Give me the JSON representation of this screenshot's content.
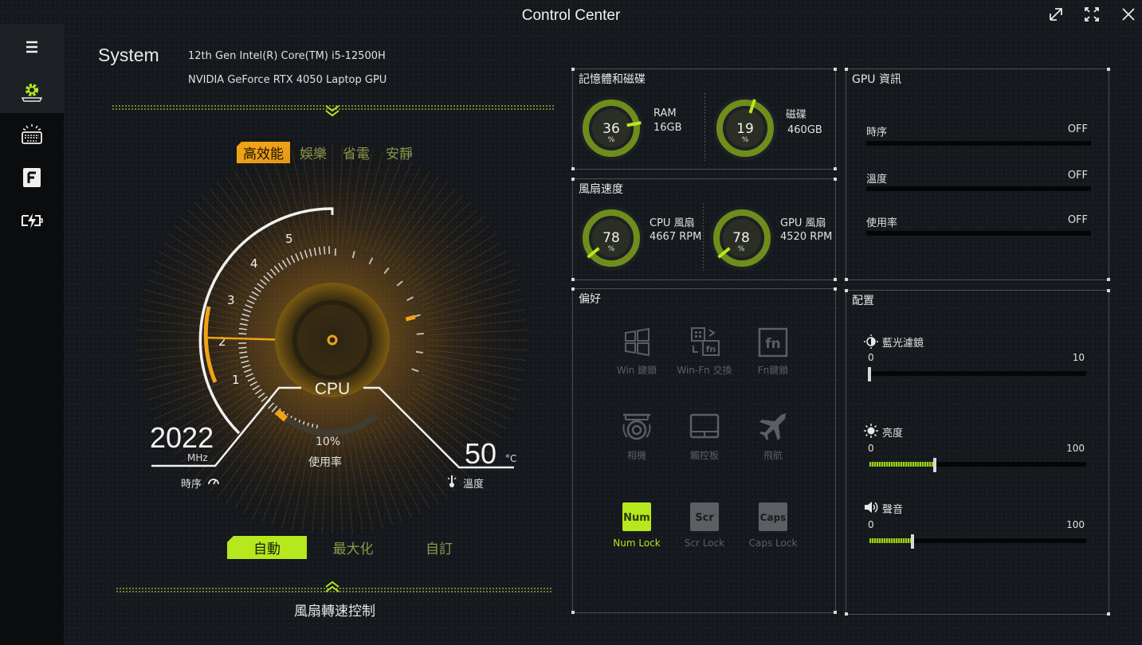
{
  "window": {
    "title": "Control Center",
    "buttons": [
      "restore-icon",
      "fullscreen-icon",
      "close-icon"
    ]
  },
  "sidebar": {
    "items": [
      {
        "icon": "hamburger-menu-icon"
      },
      {
        "icon": "gear-icon",
        "active": true
      },
      {
        "icon": "keyboard-backlight-icon"
      },
      {
        "icon": "f-key-icon"
      },
      {
        "icon": "battery-charge-icon"
      }
    ]
  },
  "system": {
    "label": "System",
    "cpu": "12th Gen Intel(R) Core(TM) i5-12500H",
    "gpu": "NVIDIA GeForce RTX 4050 Laptop GPU"
  },
  "power_modes": {
    "items": [
      "高效能",
      "娛樂",
      "省電",
      "安靜"
    ],
    "selected": "高效能"
  },
  "gauge": {
    "ticks": [
      "1",
      "2",
      "3",
      "4",
      "5"
    ],
    "center_label": "CPU",
    "clock_value": "2022",
    "clock_unit": "MHz",
    "clock_label": "時序",
    "usage_value": "10%",
    "usage_label": "使用率",
    "usage_fraction": 0.1,
    "temp_value": "50",
    "temp_unit": "°C",
    "temp_label": "溫度",
    "colors": {
      "accent": "#f0a218",
      "ring": "#f0f0f0"
    }
  },
  "fan_modes": {
    "items": [
      "自動",
      "最大化",
      "自訂"
    ],
    "selected": "自動",
    "control_label": "風扇轉速控制"
  },
  "memory_panel": {
    "title": "記憶體和磁碟",
    "ram": {
      "value": "36",
      "unit": "%",
      "label": "RAM",
      "sub": "16GB",
      "fraction": 0.36
    },
    "disk": {
      "value": "19",
      "unit": "%",
      "label": "磁碟",
      "sub": "460GB",
      "fraction": 0.19
    }
  },
  "fan_panel": {
    "title": "風扇速度",
    "cpu": {
      "value": "78",
      "unit": "%",
      "label": "CPU 風扇",
      "sub": "4667 RPM",
      "fraction": 0.78
    },
    "gpu": {
      "value": "78",
      "unit": "%",
      "label": "GPU 風扇",
      "sub": "4520 RPM",
      "fraction": 0.78
    }
  },
  "gpu_panel": {
    "title": "GPU 資訊",
    "rows": [
      {
        "label": "時序",
        "value": "OFF"
      },
      {
        "label": "溫度",
        "value": "OFF"
      },
      {
        "label": "使用率",
        "value": "OFF"
      }
    ]
  },
  "pref_panel": {
    "title": "偏好",
    "items": [
      {
        "label": "Win 鍵鎖",
        "icon": "windows-icon",
        "on": false
      },
      {
        "label": "Win-Fn 交換",
        "icon": "win-fn-swap-icon",
        "on": false
      },
      {
        "label": "Fn鍵鎖",
        "icon": "fn-lock-icon",
        "on": false
      },
      {
        "label": "相機",
        "icon": "camera-icon",
        "on": false
      },
      {
        "label": "觸控板",
        "icon": "touchpad-icon",
        "on": false
      },
      {
        "label": "飛航",
        "icon": "airplane-icon",
        "on": false
      },
      {
        "label": "Num Lock",
        "icon": "num-lock-icon",
        "key": "Num",
        "on": true
      },
      {
        "label": "Scr Lock",
        "icon": "scroll-lock-icon",
        "key": "Scr",
        "on": false
      },
      {
        "label": "Caps Lock",
        "icon": "caps-lock-icon",
        "key": "Caps",
        "on": false
      }
    ]
  },
  "config_panel": {
    "title": "配置",
    "sliders": [
      {
        "label": "藍光濾鏡",
        "icon": "blue-light-icon",
        "min": "0",
        "max": "10",
        "fraction": 0.0
      },
      {
        "label": "亮度",
        "icon": "brightness-icon",
        "min": "0",
        "max": "100",
        "fraction": 0.3
      },
      {
        "label": "聲音",
        "icon": "volume-icon",
        "min": "0",
        "max": "100",
        "fraction": 0.2
      }
    ]
  }
}
